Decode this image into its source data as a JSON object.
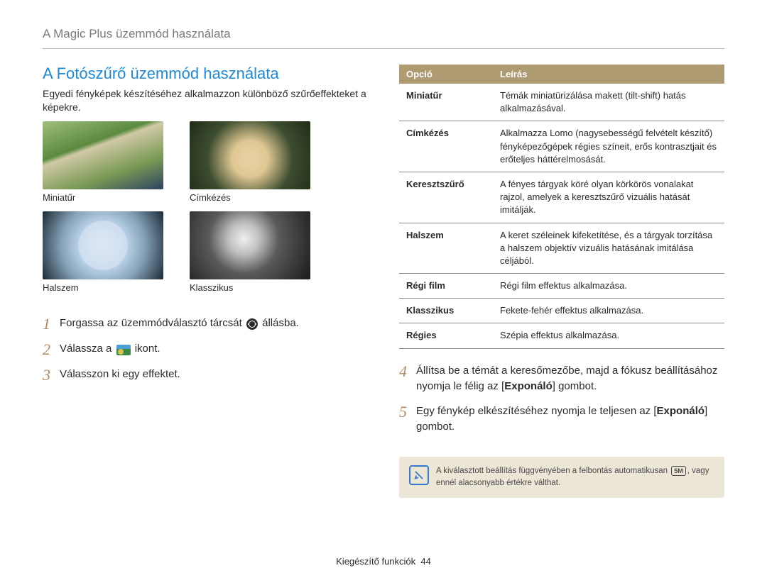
{
  "breadcrumb": "A Magic Plus üzemmód használata",
  "section_title": "A Fotószűrő üzemmód használata",
  "intro": "Egyedi fényképek készítéséhez alkalmazzon különböző szűrőeffekteket a képekre.",
  "thumbs": {
    "miniatur": "Miniatűr",
    "cimkezes": "Címkézés",
    "halszem": "Halszem",
    "klasszikus": "Klasszikus"
  },
  "steps": {
    "s1_pre": "Forgassa az üzemmódválasztó tárcsát ",
    "s1_post": " állásba.",
    "s2_pre": "Válassza a ",
    "s2_post": " ikont.",
    "s3": "Válasszon ki egy effektet.",
    "s4_a": "Állítsa be a témát a keresőmezőbe, majd a fókusz beállításához nyomja le félig az [",
    "s4_b": "Exponáló",
    "s4_c": "] gombot.",
    "s5_a": "Egy fénykép elkészítéséhez nyomja le teljesen az [",
    "s5_b": "Exponáló",
    "s5_c": "] gombot."
  },
  "table": {
    "head_option": "Opció",
    "head_desc": "Leírás",
    "rows": [
      {
        "name": "Miniatűr",
        "desc": "Témák miniatürizálása makett (tilt-shift) hatás alkalmazásával."
      },
      {
        "name": "Címkézés",
        "desc": "Alkalmazza Lomo (nagysebességű felvételt készítő) fényképezőgépek régies színeit, erős kontrasztjait és erőteljes háttérelmosását."
      },
      {
        "name": "Keresztszűrő",
        "desc": "A fényes tárgyak köré olyan körkörös vonalakat rajzol, amelyek a keresztszűrő vizuális hatását imitálják."
      },
      {
        "name": "Halszem",
        "desc": "A keret széleinek kifeketítése, és a tárgyak torzítása a halszem objektív vizuális hatásának imitálása céljából."
      },
      {
        "name": "Régi film",
        "desc": "Régi film effektus alkalmazása."
      },
      {
        "name": "Klasszikus",
        "desc": "Fekete-fehér effektus alkalmazása."
      },
      {
        "name": "Régies",
        "desc": "Szépia effektus alkalmazása."
      }
    ]
  },
  "note": {
    "text_a": "A kiválasztott beállítás függvényében a felbontás automatikusan ",
    "badge": "5M",
    "text_b": ", vagy ennél alacsonyabb értékre válthat."
  },
  "footer": {
    "label": "Kiegészítő funkciók",
    "page": "44"
  }
}
